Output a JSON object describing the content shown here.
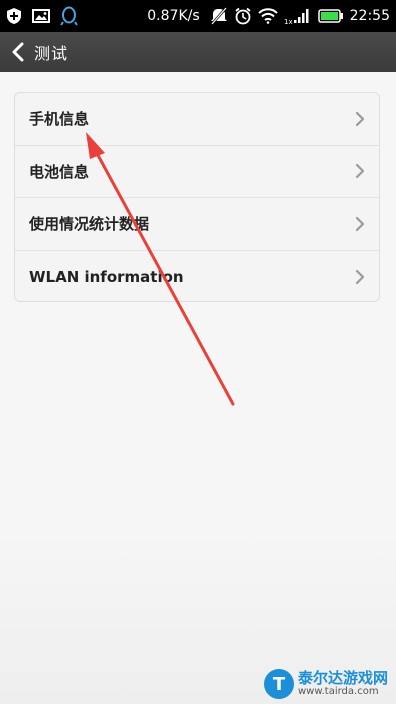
{
  "status_bar": {
    "net_speed": "0.87K/s",
    "time": "22:55",
    "signal_label": "1x",
    "left_icons": [
      "shield-icon",
      "image-icon",
      "qq-icon"
    ],
    "right_icons": [
      "mute-icon",
      "alarm-icon",
      "wifi-icon",
      "signal-icon",
      "battery-icon"
    ]
  },
  "header": {
    "back_icon": "chevron-left-icon",
    "title": "测试"
  },
  "list": {
    "items": [
      {
        "label": "手机信息"
      },
      {
        "label": "电池信息"
      },
      {
        "label": "使用情况统计数据"
      },
      {
        "label": "WLAN information"
      }
    ]
  },
  "annotation": {
    "type": "red-arrow",
    "color": "#e8413b"
  },
  "watermark": {
    "name": "泰尔达游戏网",
    "url": "www.tairda.com",
    "color": "#1d8fd6"
  },
  "colors": {
    "status_bar_bg": "#000000",
    "action_bar_bg": "#424242",
    "page_bg": "#f6f6f6",
    "battery_green": "#3ddc4a"
  }
}
